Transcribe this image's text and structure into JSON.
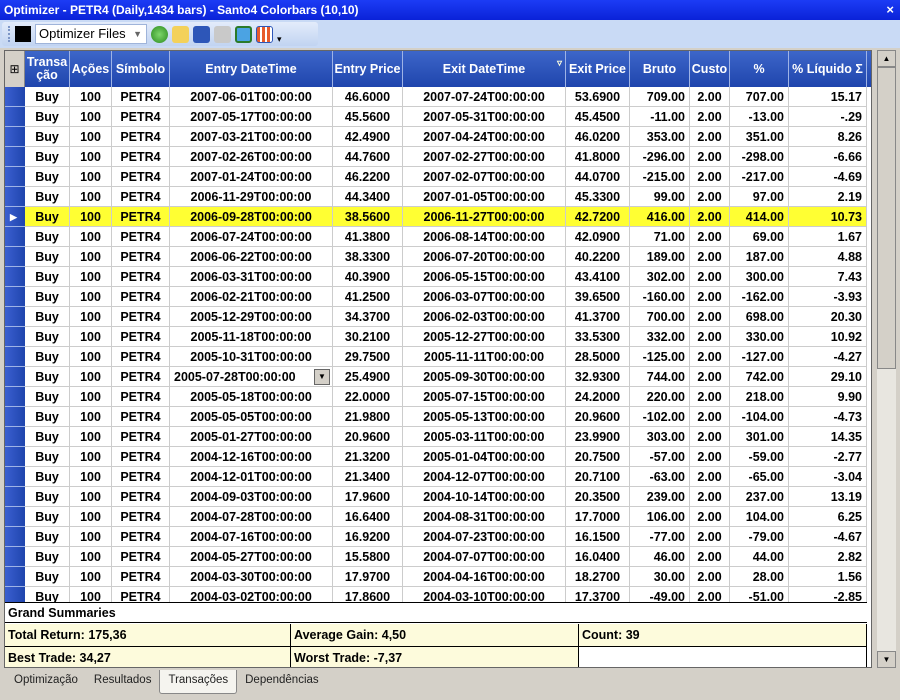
{
  "window": {
    "title": "Optimizer - PETR4 (Daily,1434 bars) - Santo4 Colorbars (10,10)",
    "close": "×"
  },
  "toolbar": {
    "files_select": "Optimizer Files",
    "icons": [
      "color-swatch",
      "refresh-icon",
      "open-folder-icon",
      "save-icon",
      "print-icon",
      "add-icon",
      "grid-icon"
    ]
  },
  "columns": [
    "Transa ção",
    "Ações",
    "Símbolo",
    "Entry DateTime",
    "Entry Price",
    "Exit DateTime",
    "Exit Price",
    "Bruto",
    "Custo",
    "%",
    "% Líquido Σ"
  ],
  "rows": [
    [
      "Buy",
      "100",
      "PETR4",
      "2007-06-01T00:00:00",
      "46.6000",
      "2007-07-24T00:00:00",
      "53.6900",
      "709.00",
      "2.00",
      "707.00",
      "15.17"
    ],
    [
      "Buy",
      "100",
      "PETR4",
      "2007-05-17T00:00:00",
      "45.5600",
      "2007-05-31T00:00:00",
      "45.4500",
      "-11.00",
      "2.00",
      "-13.00",
      "-.29"
    ],
    [
      "Buy",
      "100",
      "PETR4",
      "2007-03-21T00:00:00",
      "42.4900",
      "2007-04-24T00:00:00",
      "46.0200",
      "353.00",
      "2.00",
      "351.00",
      "8.26"
    ],
    [
      "Buy",
      "100",
      "PETR4",
      "2007-02-26T00:00:00",
      "44.7600",
      "2007-02-27T00:00:00",
      "41.8000",
      "-296.00",
      "2.00",
      "-298.00",
      "-6.66"
    ],
    [
      "Buy",
      "100",
      "PETR4",
      "2007-01-24T00:00:00",
      "46.2200",
      "2007-02-07T00:00:00",
      "44.0700",
      "-215.00",
      "2.00",
      "-217.00",
      "-4.69"
    ],
    [
      "Buy",
      "100",
      "PETR4",
      "2006-11-29T00:00:00",
      "44.3400",
      "2007-01-05T00:00:00",
      "45.3300",
      "99.00",
      "2.00",
      "97.00",
      "2.19"
    ],
    [
      "Buy",
      "100",
      "PETR4",
      "2006-09-28T00:00:00",
      "38.5600",
      "2006-11-27T00:00:00",
      "42.7200",
      "416.00",
      "2.00",
      "414.00",
      "10.73"
    ],
    [
      "Buy",
      "100",
      "PETR4",
      "2006-07-24T00:00:00",
      "41.3800",
      "2006-08-14T00:00:00",
      "42.0900",
      "71.00",
      "2.00",
      "69.00",
      "1.67"
    ],
    [
      "Buy",
      "100",
      "PETR4",
      "2006-06-22T00:00:00",
      "38.3300",
      "2006-07-20T00:00:00",
      "40.2200",
      "189.00",
      "2.00",
      "187.00",
      "4.88"
    ],
    [
      "Buy",
      "100",
      "PETR4",
      "2006-03-31T00:00:00",
      "40.3900",
      "2006-05-15T00:00:00",
      "43.4100",
      "302.00",
      "2.00",
      "300.00",
      "7.43"
    ],
    [
      "Buy",
      "100",
      "PETR4",
      "2006-02-21T00:00:00",
      "41.2500",
      "2006-03-07T00:00:00",
      "39.6500",
      "-160.00",
      "2.00",
      "-162.00",
      "-3.93"
    ],
    [
      "Buy",
      "100",
      "PETR4",
      "2005-12-29T00:00:00",
      "34.3700",
      "2006-02-03T00:00:00",
      "41.3700",
      "700.00",
      "2.00",
      "698.00",
      "20.30"
    ],
    [
      "Buy",
      "100",
      "PETR4",
      "2005-11-18T00:00:00",
      "30.2100",
      "2005-12-27T00:00:00",
      "33.5300",
      "332.00",
      "2.00",
      "330.00",
      "10.92"
    ],
    [
      "Buy",
      "100",
      "PETR4",
      "2005-10-31T00:00:00",
      "29.7500",
      "2005-11-11T00:00:00",
      "28.5000",
      "-125.00",
      "2.00",
      "-127.00",
      "-4.27"
    ],
    [
      "Buy",
      "100",
      "PETR4",
      "2005-07-28T00:00:00",
      "25.4900",
      "2005-09-30T00:00:00",
      "32.9300",
      "744.00",
      "2.00",
      "742.00",
      "29.10"
    ],
    [
      "Buy",
      "100",
      "PETR4",
      "2005-05-18T00:00:00",
      "22.0000",
      "2005-07-15T00:00:00",
      "24.2000",
      "220.00",
      "2.00",
      "218.00",
      "9.90"
    ],
    [
      "Buy",
      "100",
      "PETR4",
      "2005-05-05T00:00:00",
      "21.9800",
      "2005-05-13T00:00:00",
      "20.9600",
      "-102.00",
      "2.00",
      "-104.00",
      "-4.73"
    ],
    [
      "Buy",
      "100",
      "PETR4",
      "2005-01-27T00:00:00",
      "20.9600",
      "2005-03-11T00:00:00",
      "23.9900",
      "303.00",
      "2.00",
      "301.00",
      "14.35"
    ],
    [
      "Buy",
      "100",
      "PETR4",
      "2004-12-16T00:00:00",
      "21.3200",
      "2005-01-04T00:00:00",
      "20.7500",
      "-57.00",
      "2.00",
      "-59.00",
      "-2.77"
    ],
    [
      "Buy",
      "100",
      "PETR4",
      "2004-12-01T00:00:00",
      "21.3400",
      "2004-12-07T00:00:00",
      "20.7100",
      "-63.00",
      "2.00",
      "-65.00",
      "-3.04"
    ],
    [
      "Buy",
      "100",
      "PETR4",
      "2004-09-03T00:00:00",
      "17.9600",
      "2004-10-14T00:00:00",
      "20.3500",
      "239.00",
      "2.00",
      "237.00",
      "13.19"
    ],
    [
      "Buy",
      "100",
      "PETR4",
      "2004-07-28T00:00:00",
      "16.6400",
      "2004-08-31T00:00:00",
      "17.7000",
      "106.00",
      "2.00",
      "104.00",
      "6.25"
    ],
    [
      "Buy",
      "100",
      "PETR4",
      "2004-07-16T00:00:00",
      "16.9200",
      "2004-07-23T00:00:00",
      "16.1500",
      "-77.00",
      "2.00",
      "-79.00",
      "-4.67"
    ],
    [
      "Buy",
      "100",
      "PETR4",
      "2004-05-27T00:00:00",
      "15.5800",
      "2004-07-07T00:00:00",
      "16.0400",
      "46.00",
      "2.00",
      "44.00",
      "2.82"
    ],
    [
      "Buy",
      "100",
      "PETR4",
      "2004-03-30T00:00:00",
      "17.9700",
      "2004-04-16T00:00:00",
      "18.2700",
      "30.00",
      "2.00",
      "28.00",
      "1.56"
    ],
    [
      "Buy",
      "100",
      "PETR4",
      "2004-03-02T00:00:00",
      "17.8600",
      "2004-03-10T00:00:00",
      "17.3700",
      "-49.00",
      "2.00",
      "-51.00",
      "-2.85"
    ]
  ],
  "selected_row": 6,
  "dropdown_row": 14,
  "colors": {
    "header": "#1f45ad",
    "selected": "#ffff33",
    "summary": "#fdfbdc"
  },
  "summary": {
    "title": "Grand Summaries",
    "total_return": "Total Return: 175,36",
    "average_gain": "Average Gain: 4,50",
    "count": "Count: 39",
    "best_trade": "Best Trade: 34,27",
    "worst_trade": "Worst Trade: -7,37"
  },
  "tabs": [
    {
      "label": "Optimização"
    },
    {
      "label": "Resultados"
    },
    {
      "label": "Transações",
      "active": true
    },
    {
      "label": "Dependências"
    }
  ]
}
